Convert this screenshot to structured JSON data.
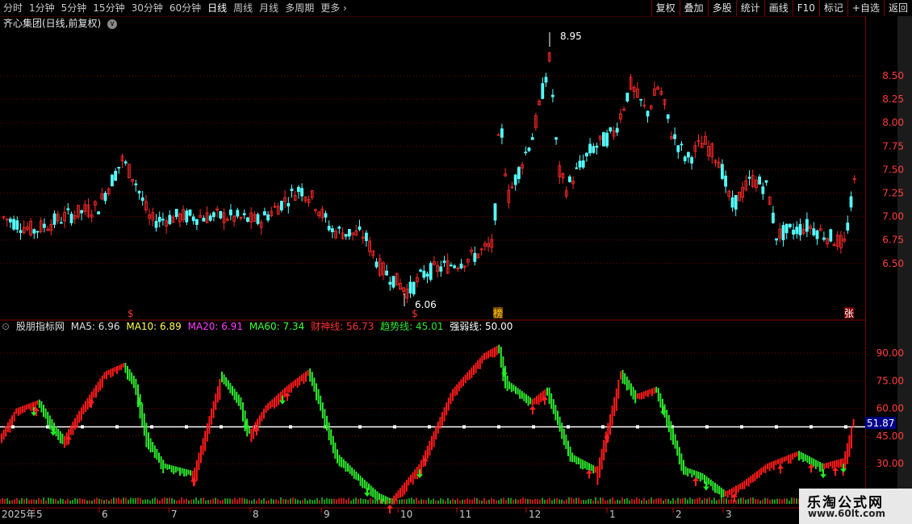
{
  "toolbar": {
    "periods": [
      "分时",
      "1分钟",
      "5分钟",
      "15分钟",
      "30分钟",
      "60分钟",
      "日线",
      "周线",
      "月线",
      "多周期",
      "更多"
    ],
    "active_period": "日线",
    "right_buttons": [
      "复权",
      "叠加",
      "多股",
      "统计",
      "画线",
      "F10",
      "标记",
      "+自选",
      "返回"
    ]
  },
  "main_chart": {
    "title": "齐心集团(日线,前复权)",
    "high_label": "8.95",
    "low_label": "6.06",
    "price_axis": [
      "8.50",
      "8.25",
      "8.00",
      "7.75",
      "7.50",
      "7.25",
      "7.00",
      "6.75",
      "6.50"
    ],
    "markers": [
      "$",
      "$",
      "榜",
      "张"
    ]
  },
  "indicator": {
    "name": "股朋指标网",
    "ma5": "MA5: 6.96",
    "ma10": "MA10: 6.89",
    "ma20": "MA20: 6.91",
    "ma60": "MA60: 7.34",
    "caishen": "财神线: 56.73",
    "qushi": "趋势线: 45.01",
    "qiangruo": "强弱线: 50.00",
    "axis": [
      "90.00",
      "75.00",
      "60.00",
      "45.00",
      "30.00"
    ],
    "current_value": "51.87"
  },
  "date_axis": [
    "2025年",
    "5",
    "6",
    "7",
    "8",
    "9",
    "10",
    "11",
    "12",
    "1",
    "2",
    "3"
  ],
  "colors": {
    "up": "#ff2a2a",
    "down": "#54ffff",
    "ind_up": "#ff1a1a",
    "ind_down": "#2ee62e",
    "line": "#ffffff"
  },
  "watermark": {
    "title": "乐淘公式网",
    "url": "www.60lt.com"
  },
  "chart_data": {
    "type": "candlestick",
    "price_ylim": [
      6.06,
      8.95
    ],
    "x": [
      "2025-05",
      "2025-06",
      "2025-07",
      "2025-08",
      "2025-09",
      "2025-10",
      "2025-11",
      "2025-12",
      "2026-01",
      "2026-02",
      "2026-03"
    ],
    "close_approx": [
      6.9,
      7.3,
      6.95,
      7.1,
      6.6,
      6.3,
      7.4,
      7.8,
      8.3,
      7.2,
      6.9
    ]
  }
}
